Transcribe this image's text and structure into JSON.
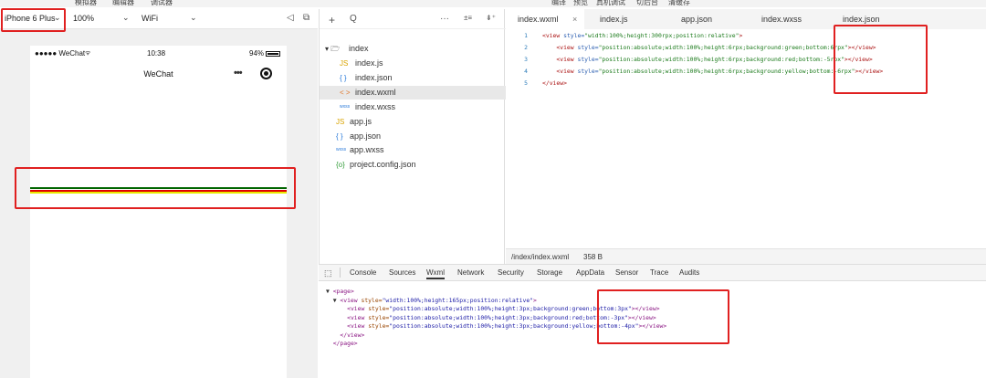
{
  "menu": [
    "模拟器",
    "编辑器",
    "调试器",
    "编译",
    "预览",
    "真机调试",
    "切后台",
    "清缓存"
  ],
  "sim_toolbar": {
    "device": "iPhone 6 Plus",
    "zoom": "100%",
    "network": "WiFi"
  },
  "phone": {
    "carrier": "●●●●● WeChat",
    "time": "10:38",
    "battery": "94%",
    "nav_title": "WeChat",
    "nav_menu": "•••",
    "line_colors": [
      "#006400",
      "#e00000",
      "#e8e800"
    ]
  },
  "tree": {
    "toolbar": [
      "+",
      "Q",
      "···",
      "±≡",
      "⇟⁺"
    ],
    "items": [
      {
        "icon": "▾ 🗁",
        "name": "index",
        "level": 0,
        "icon_color": "#333"
      },
      {
        "icon": "JS",
        "name": "index.js",
        "level": 1,
        "icon_color": "#d9a400"
      },
      {
        "icon": "{ }",
        "name": "index.json",
        "level": 1,
        "icon_color": "#2a7ad9"
      },
      {
        "icon": "< >",
        "name": "index.wxml",
        "level": 1,
        "icon_color": "#e0762a"
      },
      {
        "icon": "wxss",
        "name": "index.wxss",
        "level": 1,
        "icon_color": "#2a7ad9"
      },
      {
        "icon": "JS",
        "name": "app.js",
        "level": 0,
        "icon_color": "#d9a400"
      },
      {
        "icon": "{ }",
        "name": "app.json",
        "level": 0,
        "icon_color": "#2a7ad9"
      },
      {
        "icon": "wxss",
        "name": "app.wxss",
        "level": 0,
        "icon_color": "#2a7ad9"
      },
      {
        "icon": "{o}",
        "name": "project.config.json",
        "level": 0,
        "icon_color": "#3aa040"
      }
    ],
    "active_index": 3
  },
  "editor": {
    "tabs": [
      "index.wxml",
      "index.js",
      "app.json",
      "index.wxss",
      "index.json"
    ],
    "close_icon": "×",
    "lines": [
      {
        "n": "1",
        "indent": "",
        "tag": "<view",
        "attr": " style=",
        "val": "\"width:100%;height:300rpx;position:relative\"",
        "end": ">"
      },
      {
        "n": "2",
        "indent": "    ",
        "tag": "<view",
        "attr": " style=",
        "val": "\"position:absolute;width:100%;height:6rpx;background:green;bottom:6rpx\"",
        "end": "></view>"
      },
      {
        "n": "3",
        "indent": "    ",
        "tag": "<view",
        "attr": " style=",
        "val": "\"position:absolute;width:100%;height:6rpx;background:red;bottom:-5rpx\"",
        "end": "></view>"
      },
      {
        "n": "4",
        "indent": "    ",
        "tag": "<view",
        "attr": " style=",
        "val": "\"position:absolute;width:100%;height:6rpx;background:yellow;bottom:-6rpx\"",
        "end": "></view>"
      },
      {
        "n": "5",
        "indent": "",
        "tag": "</view>",
        "attr": "",
        "val": "",
        "end": ""
      }
    ],
    "status_path": "/index/index.wxml",
    "status_size": "358 B"
  },
  "devtools": {
    "tabs": [
      "Console",
      "Sources",
      "Wxml",
      "Network",
      "Security",
      "Storage",
      "AppData",
      "Sensor",
      "Trace",
      "Audits"
    ],
    "active_tab": "Wxml",
    "lines": [
      {
        "pre": "▼ ",
        "tag": "<page>",
        "attr": "",
        "val": "",
        "end": ""
      },
      {
        "pre": "  ▼ ",
        "tag": "<view",
        "attr": " style=",
        "val": "\"width:100%;height:165px;position:relative\"",
        "end": ">"
      },
      {
        "pre": "      ",
        "tag": "<view",
        "attr": " style=",
        "val": "\"position:absolute;width:100%;height:3px;background:green;bottom:3px\"",
        "end": "></view>"
      },
      {
        "pre": "      ",
        "tag": "<view",
        "attr": " style=",
        "val": "\"position:absolute;width:100%;height:3px;background:red;bottom:-3px\"",
        "end": "></view>"
      },
      {
        "pre": "      ",
        "tag": "<view",
        "attr": " style=",
        "val": "\"position:absolute;width:100%;height:3px;background:yellow;bottom:-4px\"",
        "end": "></view>"
      },
      {
        "pre": "    ",
        "tag": "</view>",
        "attr": "",
        "val": "",
        "end": ""
      },
      {
        "pre": "  ",
        "tag": "</page>",
        "attr": "",
        "val": "",
        "end": ""
      }
    ]
  }
}
